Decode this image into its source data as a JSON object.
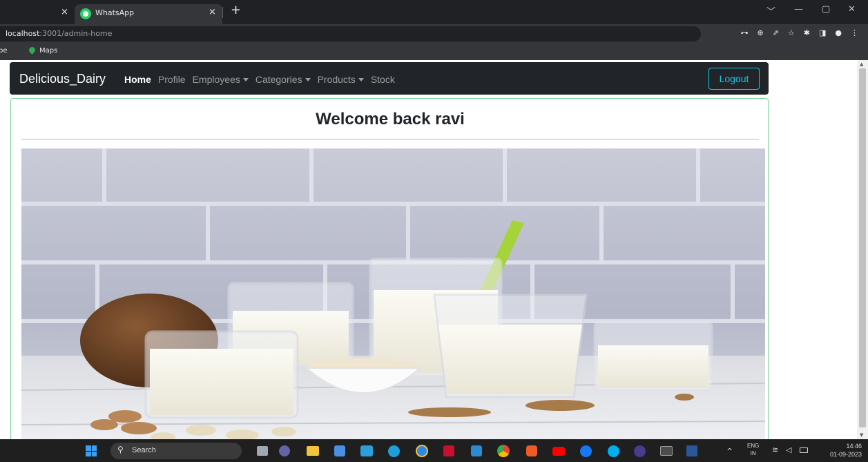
{
  "browser": {
    "tab_title": "WhatsApp",
    "tab_close": "×",
    "newtab": "+",
    "url_host": "localhost",
    "url_rest": ":3001/admin-home",
    "bookmark_partial": "be",
    "bookmark_maps": "Maps",
    "window_minimize": "—",
    "window_restore": "▢",
    "window_close": "✕",
    "window_dropdown": "﹀"
  },
  "navbar": {
    "brand": "Delicious_Dairy",
    "links": {
      "home": "Home",
      "profile": "Profile",
      "employees": "Employees",
      "categories": "Categories",
      "products": "Products",
      "stock": "Stock"
    },
    "logout": "Logout",
    "accent_color": "#0dcaf0"
  },
  "card": {
    "welcome": "Welcome back ravi",
    "border_color": "#79d39a"
  },
  "taskbar": {
    "search": "Search",
    "lang_top": "ENG",
    "lang_bottom": "IN",
    "time": "14:46",
    "date": "01-09-2023",
    "chevron": "^"
  }
}
